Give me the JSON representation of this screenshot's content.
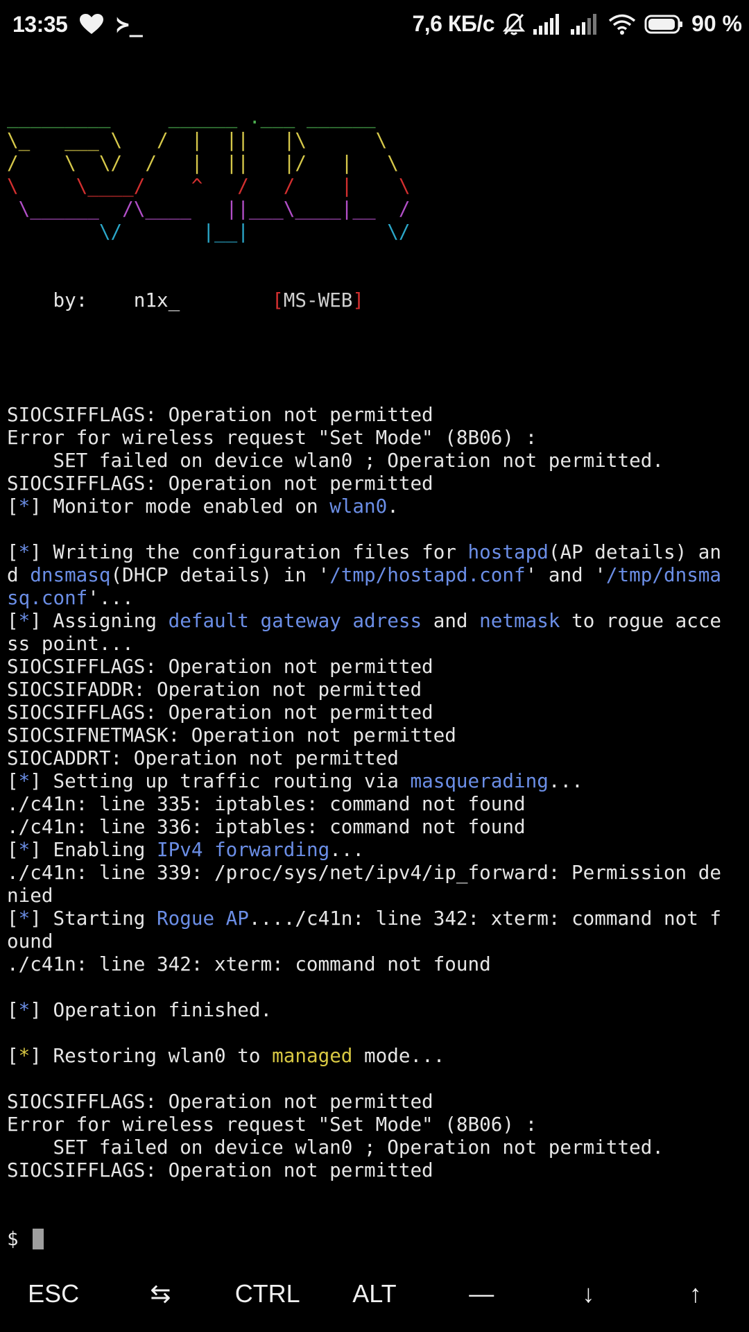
{
  "status_bar": {
    "time": "13:35",
    "notif_icons": [
      "heart-icon",
      "terminal-prompt-icon"
    ],
    "terminal_glyph": "≻_",
    "speed": "7,6 КБ/с",
    "status_icons": [
      "muted-bell-icon",
      "signal-icon",
      "signal-icon",
      "wifi-icon",
      "battery-icon"
    ],
    "battery_percent": "90 %"
  },
  "terminal": {
    "banner": {
      "rows": [
        [
          {
            "t": "_________",
            "c": "green"
          },
          {
            "t": "     ",
            "c": ""
          },
          {
            "t": "______",
            "c": "green"
          },
          {
            "t": " .",
            "c": "green"
          },
          {
            "t": "___ ______",
            "c": "green"
          }
        ],
        [
          {
            "t": "\\_   ___ \\   /  |  ||   |\\      \\",
            "c": "yellow"
          }
        ],
        [
          {
            "t": "/    \\  \\/  /   |  ||   |/   |   \\",
            "c": "yellow"
          }
        ],
        [
          {
            "t": "\\     \\____/    ^   /   /    |    \\",
            "c": "red"
          }
        ],
        [
          {
            "t": " \\______  /\\____   ||___\\____|__  /",
            "c": "magenta"
          }
        ],
        [
          {
            "t": "        \\/       |__|            \\/",
            "c": "cyan"
          }
        ]
      ],
      "byline": {
        "prefix": "    by:    ",
        "author": "n1x_",
        "gap": "        ",
        "open": "[",
        "tag": "MS-WEB",
        "close": "]"
      }
    },
    "output_lines": [
      [
        {
          "t": ""
        }
      ],
      [
        {
          "t": ""
        }
      ],
      [
        {
          "t": "SIOCSIFFLAGS: Operation not permitted"
        }
      ],
      [
        {
          "t": "Error for wireless request \"Set Mode\" (8B06) :"
        }
      ],
      [
        {
          "t": "    SET failed on device wlan0 ; Operation not permitted."
        }
      ],
      [
        {
          "t": "SIOCSIFFLAGS: Operation not permitted"
        }
      ],
      [
        {
          "t": "["
        },
        {
          "t": "*",
          "c": "blue"
        },
        {
          "t": "] Monitor mode enabled on "
        },
        {
          "t": "wlan0",
          "c": "blue"
        },
        {
          "t": "."
        }
      ],
      [
        {
          "t": ""
        }
      ],
      [
        {
          "t": "["
        },
        {
          "t": "*",
          "c": "blue"
        },
        {
          "t": "] Writing the configuration files for "
        },
        {
          "t": "hostapd",
          "c": "blue"
        },
        {
          "t": "(AP details) an"
        }
      ],
      [
        {
          "t": "d "
        },
        {
          "t": "dnsmasq",
          "c": "blue"
        },
        {
          "t": "(DHCP details) in '"
        },
        {
          "t": "/tmp/hostapd.conf",
          "c": "blue"
        },
        {
          "t": "' and '"
        },
        {
          "t": "/tmp/dnsma",
          "c": "blue"
        }
      ],
      [
        {
          "t": "sq.conf",
          "c": "blue"
        },
        {
          "t": "'..."
        }
      ],
      [
        {
          "t": "["
        },
        {
          "t": "*",
          "c": "blue"
        },
        {
          "t": "] Assigning "
        },
        {
          "t": "default gateway adress",
          "c": "blue"
        },
        {
          "t": " and "
        },
        {
          "t": "netmask",
          "c": "blue"
        },
        {
          "t": " to rogue acce"
        }
      ],
      [
        {
          "t": "ss point..."
        }
      ],
      [
        {
          "t": "SIOCSIFFLAGS: Operation not permitted"
        }
      ],
      [
        {
          "t": "SIOCSIFADDR: Operation not permitted"
        }
      ],
      [
        {
          "t": "SIOCSIFFLAGS: Operation not permitted"
        }
      ],
      [
        {
          "t": "SIOCSIFNETMASK: Operation not permitted"
        }
      ],
      [
        {
          "t": "SIOCADDRT: Operation not permitted"
        }
      ],
      [
        {
          "t": "["
        },
        {
          "t": "*",
          "c": "blue"
        },
        {
          "t": "] Setting up traffic routing via "
        },
        {
          "t": "masquerading",
          "c": "blue"
        },
        {
          "t": "..."
        }
      ],
      [
        {
          "t": "./c41n: line 335: iptables: command not found"
        }
      ],
      [
        {
          "t": "./c41n: line 336: iptables: command not found"
        }
      ],
      [
        {
          "t": "["
        },
        {
          "t": "*",
          "c": "blue"
        },
        {
          "t": "] Enabling "
        },
        {
          "t": "IPv4 forwarding",
          "c": "blue"
        },
        {
          "t": "..."
        }
      ],
      [
        {
          "t": "./c41n: line 339: /proc/sys/net/ipv4/ip_forward: Permission de"
        }
      ],
      [
        {
          "t": "nied"
        }
      ],
      [
        {
          "t": "["
        },
        {
          "t": "*",
          "c": "blue"
        },
        {
          "t": "] Starting "
        },
        {
          "t": "Rogue AP",
          "c": "blue"
        },
        {
          "t": "..../c41n: line 342: xterm: command not f"
        }
      ],
      [
        {
          "t": "ound"
        }
      ],
      [
        {
          "t": "./c41n: line 342: xterm: command not found"
        }
      ],
      [
        {
          "t": ""
        }
      ],
      [
        {
          "t": "["
        },
        {
          "t": "*",
          "c": "blue"
        },
        {
          "t": "] Operation finished."
        }
      ],
      [
        {
          "t": ""
        }
      ],
      [
        {
          "t": "["
        },
        {
          "t": "*",
          "c": "gold"
        },
        {
          "t": "] Restoring wlan0 to "
        },
        {
          "t": "managed",
          "c": "gold"
        },
        {
          "t": " mode..."
        }
      ],
      [
        {
          "t": ""
        }
      ],
      [
        {
          "t": "SIOCSIFFLAGS: Operation not permitted"
        }
      ],
      [
        {
          "t": "Error for wireless request \"Set Mode\" (8B06) :"
        }
      ],
      [
        {
          "t": "    SET failed on device wlan0 ; Operation not permitted."
        }
      ],
      [
        {
          "t": "SIOCSIFFLAGS: Operation not permitted"
        }
      ]
    ],
    "prompt": "$ "
  },
  "extra_keys": [
    {
      "label": "ESC",
      "name": "esc-key"
    },
    {
      "label": "⇆",
      "name": "tab-key"
    },
    {
      "label": "CTRL",
      "name": "ctrl-key"
    },
    {
      "label": "ALT",
      "name": "alt-key"
    },
    {
      "label": "—",
      "name": "dash-key"
    },
    {
      "label": "↓",
      "name": "arrow-down-key"
    },
    {
      "label": "↑",
      "name": "arrow-up-key"
    }
  ]
}
